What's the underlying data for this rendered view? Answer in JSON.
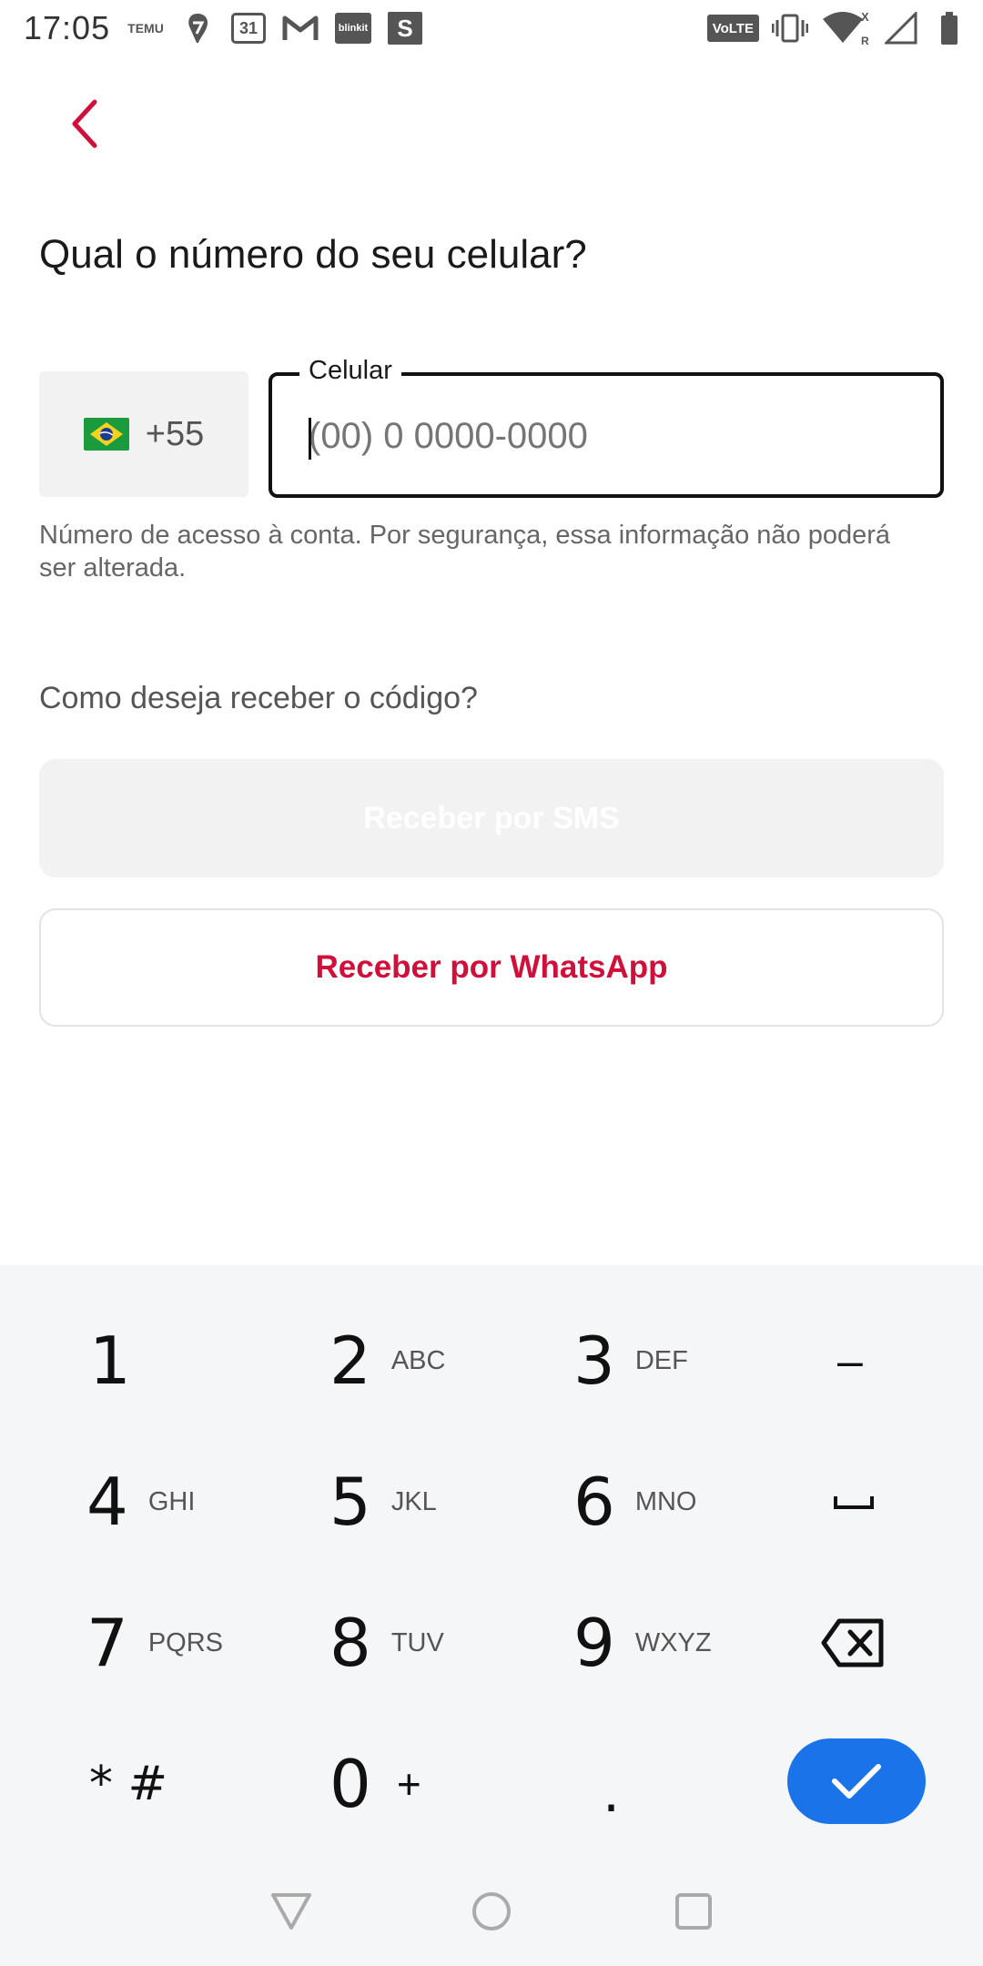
{
  "status_bar": {
    "time": "17:05",
    "left_icons": [
      "temu-icon",
      "swiggy-icon",
      "calendar-icon",
      "gmail-icon",
      "blinkit-icon",
      "s-app-icon"
    ],
    "calendar_day": "31",
    "temu_label": "TEMU",
    "blinkit_label": "blinkit",
    "s_label": "S",
    "volte_label": "VoLTE",
    "right_icons": [
      "volte-icon",
      "vibrate-icon",
      "wifi-icon",
      "signal-icon",
      "battery-icon"
    ]
  },
  "header": {
    "back_icon": "chevron-left-icon",
    "accent_color": "#d0103a"
  },
  "main": {
    "title": "Qual o número do seu celular?",
    "country_code": "+55",
    "country_flag": "brazil-flag-icon",
    "phone_label": "Celular",
    "phone_placeholder": "(00) 0 0000-0000",
    "phone_value": "",
    "helper_text": "Número de acesso à conta. Por segurança, essa informação não poderá ser alterada.",
    "question": "Como deseja receber o código?",
    "sms_button": "Receber por SMS",
    "whatsapp_button": "Receber por WhatsApp"
  },
  "keyboard": {
    "keys": [
      {
        "num": "1",
        "letters": ""
      },
      {
        "num": "2",
        "letters": "ABC"
      },
      {
        "num": "3",
        "letters": "DEF"
      },
      {
        "num": "4",
        "letters": "GHI"
      },
      {
        "num": "5",
        "letters": "JKL"
      },
      {
        "num": "6",
        "letters": "MNO"
      },
      {
        "num": "7",
        "letters": "PQRS"
      },
      {
        "num": "8",
        "letters": "TUV"
      },
      {
        "num": "9",
        "letters": "WXYZ"
      },
      {
        "num": "* #",
        "letters": ""
      },
      {
        "num": "0",
        "letters": "+"
      },
      {
        "num": ".",
        "letters": ""
      }
    ],
    "dash_key": "–",
    "done_color": "#1a73e8"
  },
  "navbar": {
    "icons": [
      "back-triangle-icon",
      "home-circle-icon",
      "recents-square-icon"
    ]
  }
}
